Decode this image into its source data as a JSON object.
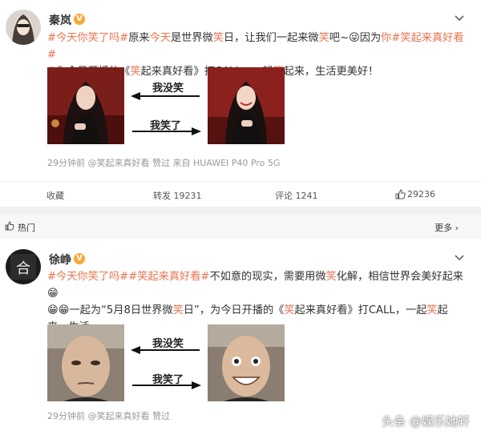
{
  "post1": {
    "author": "秦岚",
    "badge": "V",
    "text_segments": [
      {
        "t": "#今天你笑了吗#",
        "c": "tag"
      },
      {
        "t": "原来",
        "c": ""
      },
      {
        "t": "今天",
        "c": "hl"
      },
      {
        "t": "是世界微",
        "c": ""
      },
      {
        "t": "笑",
        "c": "hl"
      },
      {
        "t": "日，让我们一起来微",
        "c": ""
      },
      {
        "t": "笑",
        "c": "hl"
      },
      {
        "t": "吧~😜因为",
        "c": ""
      },
      {
        "t": "你",
        "c": "hl"
      },
      {
        "t": "#笑起来真好看#",
        "c": "tag"
      },
      {
        "t": "\n✌为今日开播的《",
        "c": ""
      },
      {
        "t": "笑",
        "c": "hl"
      },
      {
        "t": "起来真好看》打CALL，一起",
        "c": ""
      },
      {
        "t": "笑",
        "c": "hl"
      },
      {
        "t": "起来，生活更美好！",
        "c": ""
      }
    ],
    "arrow_top_label": "我没笑",
    "arrow_bottom_label": "我笑了",
    "meta": "29分钟前 @笑起来真好看 赞过   来自 HUAWEI P40 Pro 5G",
    "actions": {
      "collect": "收藏",
      "repost": "转发 19231",
      "comment": "评论 1241",
      "like": "29236"
    }
  },
  "hot_section": {
    "label": "热门",
    "more": "更多 ›"
  },
  "post2": {
    "author": "徐峥",
    "badge": "V",
    "text_segments": [
      {
        "t": "#今天你笑了吗#",
        "c": "tag"
      },
      {
        "t": "#",
        "c": "tag"
      },
      {
        "t": "笑",
        "c": "hl"
      },
      {
        "t": "起来真好看#",
        "c": "tag"
      },
      {
        "t": "不如意的现实，需要用微",
        "c": ""
      },
      {
        "t": "笑",
        "c": "hl"
      },
      {
        "t": "化解，相信世界会美好起来😁",
        "c": ""
      },
      {
        "t": "\n😁😁一起为“5月8日世界微",
        "c": ""
      },
      {
        "t": "笑",
        "c": "hl"
      },
      {
        "t": "日”，为今日开播的《",
        "c": ""
      },
      {
        "t": "笑",
        "c": "hl"
      },
      {
        "t": "起来真好看》打CALL，一起",
        "c": ""
      },
      {
        "t": "笑",
        "c": "hl"
      },
      {
        "t": "起来，生活",
        "c": ""
      },
      {
        "t": "\n更美好！",
        "c": ""
      }
    ],
    "arrow_top_label": "我没笑",
    "arrow_bottom_label": "我笑了",
    "meta": "29分钟前 @笑起来真好看 赞过"
  },
  "watermark": "头条 @娱乐她轩",
  "colors": {
    "accent": "#eb7350",
    "meta": "#999999",
    "badge": "#f7a93a"
  }
}
